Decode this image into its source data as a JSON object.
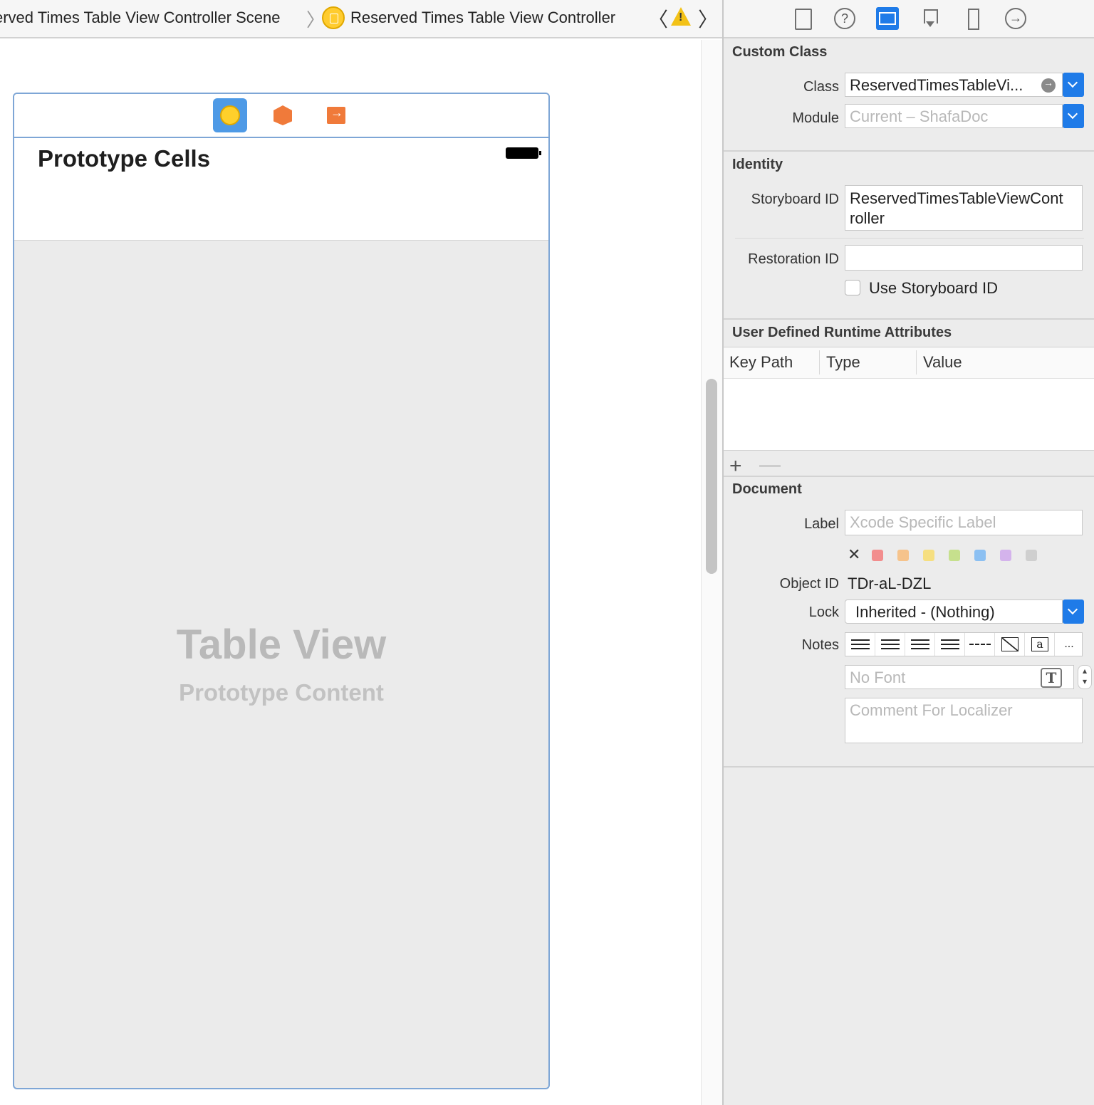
{
  "breadcrumb": {
    "scene": "erved Times Table View Controller Scene",
    "separator": "〉",
    "controller": "Reserved Times Table View Controller",
    "prev": "〈",
    "next": "〉"
  },
  "scene": {
    "header_title": "Prototype Cells",
    "placeholder_title": "Table View",
    "placeholder_subtitle": "Prototype Content"
  },
  "inspector": {
    "custom_class": {
      "title": "Custom Class",
      "class_label": "Class",
      "class_value": "ReservedTimesTableVi...",
      "module_label": "Module",
      "module_placeholder": "Current – ShafaDoc"
    },
    "identity": {
      "title": "Identity",
      "storyboard_id_label": "Storyboard ID",
      "storyboard_id_line1": "ReservedTimesTableViewCont",
      "storyboard_id_line2": "roller",
      "restoration_id_label": "Restoration ID",
      "restoration_id_value": "",
      "use_storyboard_id_label": "Use Storyboard ID"
    },
    "runtime_attributes": {
      "title": "User Defined Runtime Attributes",
      "columns": [
        "Key Path",
        "Type",
        "Value"
      ],
      "add": "+",
      "remove": "—"
    },
    "document": {
      "title": "Document",
      "label_label": "Label",
      "label_placeholder": "Xcode Specific Label",
      "clear_color": "✕",
      "label_colors": [
        "#f28d8d",
        "#f6c38b",
        "#f6df80",
        "#c6e08d",
        "#8cc0f2",
        "#d4b3ec",
        "#cfcfcf"
      ],
      "object_id_label": "Object ID",
      "object_id_value": "TDr-aL-DZL",
      "lock_label": "Lock",
      "lock_value": "Inherited - (Nothing)",
      "notes_label": "Notes",
      "notes_more": "...",
      "font_placeholder": "No Font",
      "font_icon_glyph": "T",
      "comment_placeholder": "Comment For Localizer"
    }
  }
}
